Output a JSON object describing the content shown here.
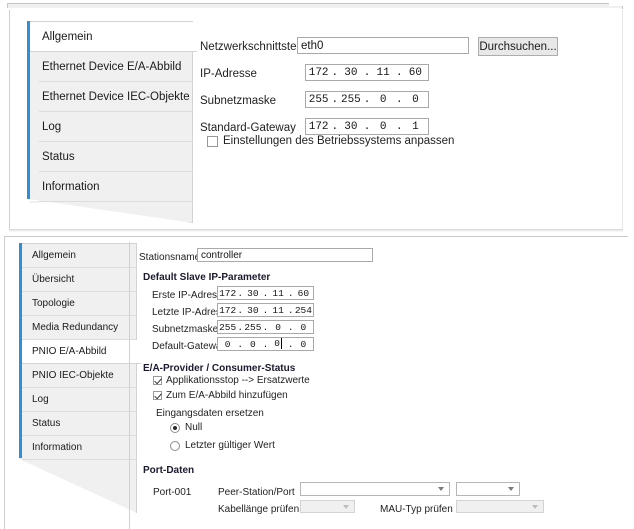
{
  "window": {
    "minimize_icon": "minimize-icon"
  },
  "top_panel": {
    "nav": {
      "items": [
        {
          "label": "Allgemein",
          "selected": true
        },
        {
          "label": "Ethernet Device E/A-Abbild",
          "selected": false
        },
        {
          "label": "Ethernet Device IEC-Objekte",
          "selected": false
        },
        {
          "label": "Log",
          "selected": false
        },
        {
          "label": "Status",
          "selected": false
        },
        {
          "label": "Information",
          "selected": false
        }
      ],
      "accent_color": "#2f8fd6"
    },
    "form": {
      "interface_label": "Netzwerkschnittstelle",
      "interface_value": "eth0",
      "browse_button": "Durchsuchen...",
      "ip_label": "IP-Adresse",
      "ip_value": [
        "172",
        "30",
        "11",
        "60"
      ],
      "subnet_label": "Subnetzmaske",
      "subnet_value": [
        "255",
        "255",
        "0",
        "0"
      ],
      "gateway_label": "Standard-Gateway",
      "gateway_value": [
        "172",
        "30",
        "0",
        "1"
      ],
      "os_checkbox_label": "Einstellungen des Betriebssystems anpassen",
      "os_checkbox_checked": false
    }
  },
  "bottom_panel": {
    "nav": {
      "items": [
        {
          "label": "Allgemein",
          "selected": false
        },
        {
          "label": "Übersicht",
          "selected": false
        },
        {
          "label": "Topologie",
          "selected": false
        },
        {
          "label": "Media Redundancy",
          "selected": false
        },
        {
          "label": "PNIO E/A-Abbild",
          "selected": true
        },
        {
          "label": "PNIO IEC-Objekte",
          "selected": false
        },
        {
          "label": "Log",
          "selected": false
        },
        {
          "label": "Status",
          "selected": false
        },
        {
          "label": "Information",
          "selected": false
        }
      ],
      "accent_color": "#2f8fd6"
    },
    "station": {
      "label": "Stationsname",
      "value": "controller"
    },
    "slave_ip": {
      "heading": "Default Slave IP-Parameter",
      "first_ip_label": "Erste IP-Adresse",
      "first_ip_value": [
        "172",
        "30",
        "11",
        "60"
      ],
      "last_ip_label": "Letzte IP-Adresse",
      "last_ip_value": [
        "172",
        "30",
        "11",
        "254"
      ],
      "subnet_label": "Subnetzmaske",
      "subnet_value": [
        "255",
        "255",
        "0",
        "0"
      ],
      "gateway_label": "Default-Gateway",
      "gateway_value": [
        "0",
        "0",
        "0",
        "0"
      ],
      "gateway_focused_octet": 2
    },
    "provider": {
      "heading": "E/A-Provider / Consumer-Status",
      "checkbox1_label": "Applikationsstop --> Ersatzwerte",
      "checkbox1_checked": true,
      "checkbox2_label": "Zum E/A-Abbild hinzufügen",
      "checkbox2_checked": true,
      "replace_label": "Eingangsdaten ersetzen",
      "radio1_label": "Null",
      "radio1_selected": true,
      "radio2_label": "Letzter gültiger Wert",
      "radio2_selected": false
    },
    "port": {
      "heading": "Port-Daten",
      "port_label": "Port-001",
      "peer_label": "Peer-Station/Port",
      "peer_value": "",
      "peer_port_value": "",
      "cable_label": "Kabellänge prüfen",
      "cable_value": "",
      "mau_label": "MAU-Typ prüfen",
      "mau_value": ""
    }
  }
}
